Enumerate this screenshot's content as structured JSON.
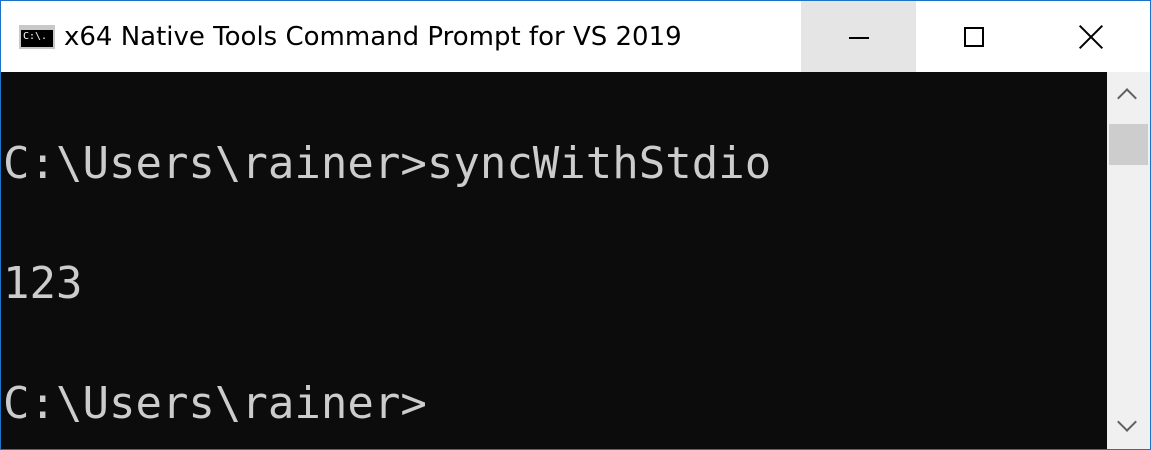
{
  "window": {
    "title": "x64 Native Tools Command Prompt for VS 2019",
    "icon_label": "C:\\.",
    "icon": "console-app-icon",
    "controls": {
      "minimize_icon": "minimize-icon",
      "maximize_icon": "maximize-icon",
      "close_icon": "close-icon"
    }
  },
  "console": {
    "lines": [
      "C:\\Users\\rainer>syncWithStdio",
      "123",
      "C:\\Users\\rainer>"
    ]
  },
  "scrollbar": {
    "up_icon": "scroll-up-arrow-icon",
    "down_icon": "scroll-down-arrow-icon"
  },
  "colors": {
    "console_background": "#0c0c0c",
    "console_text": "#cccccc",
    "window_border": "#1a73c8",
    "minimize_hover": "#e5e5e5"
  }
}
